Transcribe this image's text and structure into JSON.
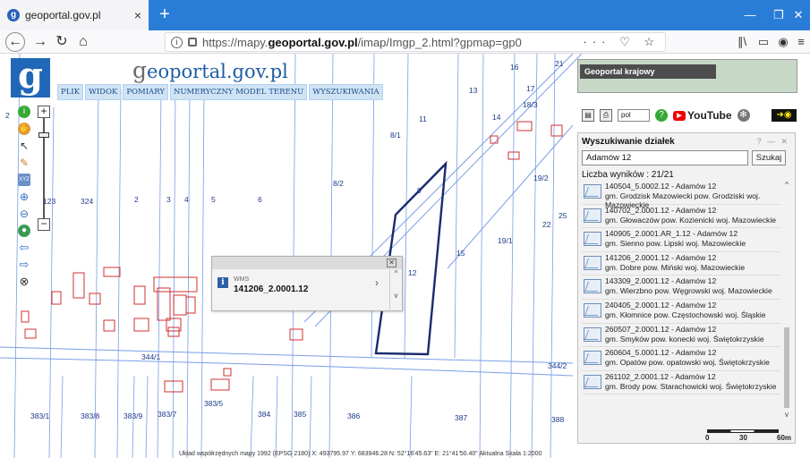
{
  "browser": {
    "tab_title": "geoportal.gov.pl",
    "tab_close": "×",
    "new_tab": "+",
    "url_prefix": "https://mapy.",
    "url_domain": "geoportal.gov.pl",
    "url_suffix": "/imap/Imgp_2.html?gpmap=gp0",
    "url_actions": "··· ♡ ☆",
    "win_min": "—",
    "win_max": "❐",
    "win_close": "✕"
  },
  "app": {
    "logo_letter": "g",
    "logo_text_g": "g",
    "logo_text_rest": "eoportal.gov.pl",
    "menu": [
      "PLIK",
      "WIDOK",
      "POMIARY",
      "NUMERYCZNY MODEL TERENU",
      "WYSZUKIWANIA"
    ]
  },
  "map": {
    "labels": [
      "16",
      "13",
      "17",
      "11",
      "8/1",
      "14",
      "19/2",
      "18/3",
      "8/2",
      "9",
      "22",
      "25",
      "15",
      "19/1",
      "12",
      "123",
      "324",
      "2",
      "3",
      "4",
      "5",
      "6",
      "344/1",
      "344/2",
      "383/1",
      "383/8",
      "383/9",
      "383/7",
      "383/5",
      "384",
      "385",
      "386",
      "387",
      "388",
      "21",
      "2"
    ],
    "scale_labels": [
      "0",
      "30",
      "60m"
    ]
  },
  "popup": {
    "close": "✕",
    "icon": "i",
    "label": "WMS",
    "value": "141206_2.0001.12",
    "arrow": "›",
    "scroll_up": "^",
    "scroll_down": "v"
  },
  "panel": {
    "minimap_title": "Geoportal krajowy",
    "lang": "pol",
    "youtube": "YouTube",
    "title": "Wyszukiwanie działek",
    "window_controls": "? — ✕",
    "search_value": "Adamów 12",
    "search_button": "Szukaj",
    "count": "Liczba wyników : 21/21",
    "results": [
      {
        "id": "140504_5.0002.12 - Adamów 12",
        "place": "gm. Grodzisk Mazowiecki pow. Grodziski woj. Mazowieckie"
      },
      {
        "id": "140702_2.0001.12 - Adamów 12",
        "place": "gm. Głowaczów pow. Kozienicki woj. Mazowieckie"
      },
      {
        "id": "140905_2.0001.AR_1.12 - Adamów 12",
        "place": "gm. Sienno pow. Lipski woj. Mazowieckie"
      },
      {
        "id": "141206_2.0001.12 - Adamów 12",
        "place": "gm. Dobre pow. Miński woj. Mazowieckie"
      },
      {
        "id": "143309_2.0001.12 - Adamów 12",
        "place": "gm. Wierzbno pow. Węgrowski woj. Mazowieckie"
      },
      {
        "id": "240405_2.0001.12 - Adamów 12",
        "place": "gm. Kłomnice pow. Częstochowski woj. Śląskie"
      },
      {
        "id": "260507_2.0001.12 - Adamów 12",
        "place": "gm. Smyków pow. konecki woj. Świętokrzyskie"
      },
      {
        "id": "260604_5.0001.12 - Adamów 12",
        "place": "gm. Opatów pow. opatowski woj. Świętokrzyskie"
      },
      {
        "id": "261102_2.0001.12 - Adamów 12",
        "place": "gm. Brody pow. Starachowicki woj. Świętokrzyskie"
      }
    ]
  },
  "status": {
    "text": "Układ współrzędnych mapy 1992 (EPSG 2180)   X: 493795.97 Y: 683946.28   N: 52°16'45.63\" E: 21°41'50.40\"  Aktualna Skala 1:2000"
  }
}
